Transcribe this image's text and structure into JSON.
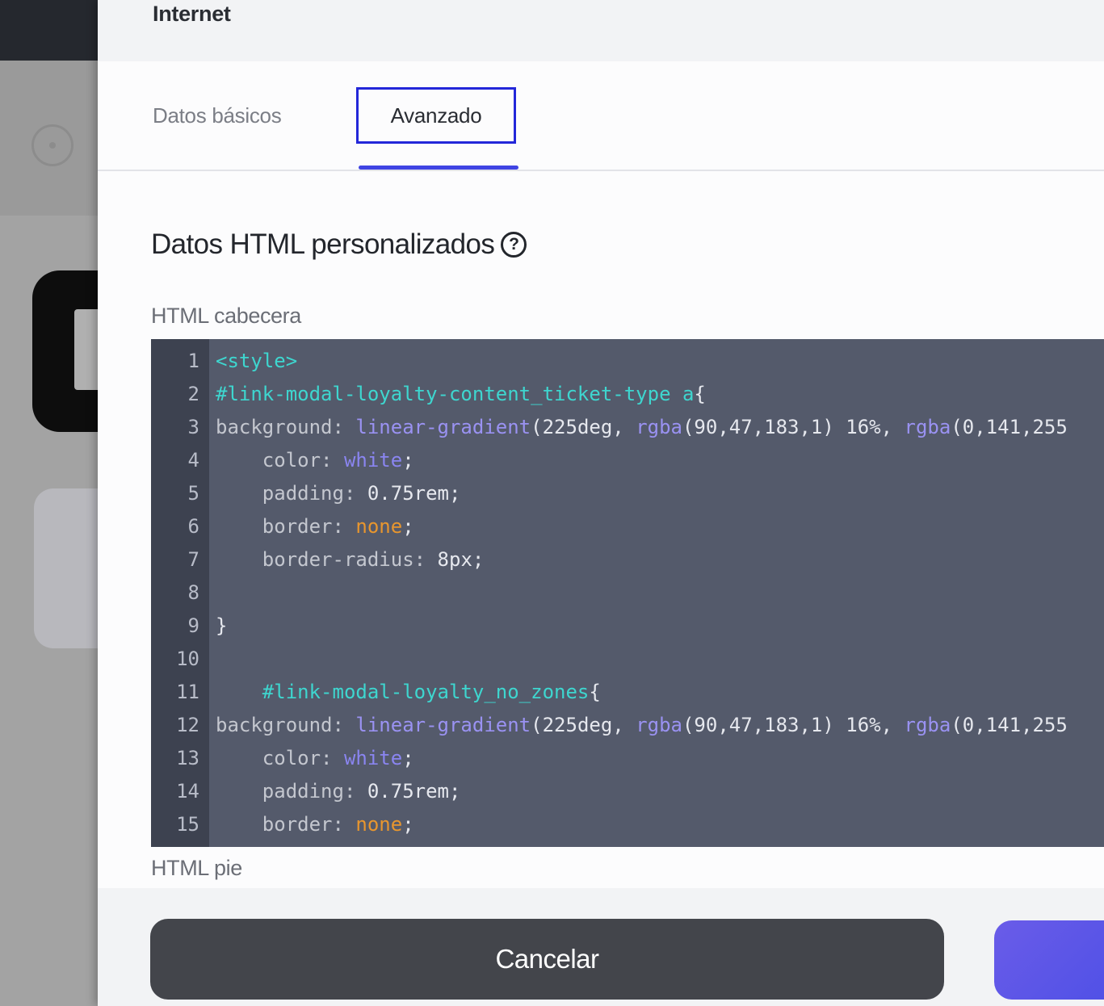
{
  "modal": {
    "title": "Internet",
    "tabs": [
      {
        "label": "Datos básicos",
        "active": false
      },
      {
        "label": "Avanzado",
        "active": true
      }
    ],
    "section_title": "Datos HTML personalizados",
    "help_icon_glyph": "?",
    "fields": {
      "head_label": "HTML cabecera",
      "foot_label": "HTML pie"
    },
    "editor": {
      "line_numbers": [
        "1",
        "2",
        "3",
        "4",
        "5",
        "6",
        "7",
        "8",
        "9",
        "10",
        "11",
        "12",
        "13",
        "14",
        "15"
      ],
      "lines": [
        {
          "tokens": [
            {
              "t": "<style>",
              "c": "tag"
            }
          ]
        },
        {
          "tokens": [
            {
              "t": "#link-modal-loyalty-content_ticket-type a",
              "c": "sel"
            },
            {
              "t": "{",
              "c": "val"
            }
          ]
        },
        {
          "tokens": [
            {
              "t": "background: ",
              "c": "prop"
            },
            {
              "t": "linear-gradient",
              "c": "fn"
            },
            {
              "t": "(225deg, ",
              "c": "val"
            },
            {
              "t": "rgba",
              "c": "fn"
            },
            {
              "t": "(90,47,183,1) 16%, ",
              "c": "val"
            },
            {
              "t": "rgba",
              "c": "fn"
            },
            {
              "t": "(0,141,255",
              "c": "val"
            }
          ]
        },
        {
          "tokens": [
            {
              "t": "    color: ",
              "c": "prop"
            },
            {
              "t": "white",
              "c": "kw"
            },
            {
              "t": ";",
              "c": "val"
            }
          ]
        },
        {
          "tokens": [
            {
              "t": "    padding: ",
              "c": "prop"
            },
            {
              "t": "0.75rem;",
              "c": "val"
            }
          ]
        },
        {
          "tokens": [
            {
              "t": "    border: ",
              "c": "prop"
            },
            {
              "t": "none",
              "c": "none"
            },
            {
              "t": ";",
              "c": "val"
            }
          ]
        },
        {
          "tokens": [
            {
              "t": "    border-radius: ",
              "c": "prop"
            },
            {
              "t": "8px;",
              "c": "val"
            }
          ]
        },
        {
          "tokens": []
        },
        {
          "tokens": [
            {
              "t": "}",
              "c": "val"
            }
          ]
        },
        {
          "tokens": []
        },
        {
          "tokens": [
            {
              "t": "    #link-modal-loyalty_no_zones",
              "c": "sel"
            },
            {
              "t": "{",
              "c": "val"
            }
          ]
        },
        {
          "tokens": [
            {
              "t": "background: ",
              "c": "prop"
            },
            {
              "t": "linear-gradient",
              "c": "fn"
            },
            {
              "t": "(225deg, ",
              "c": "val"
            },
            {
              "t": "rgba",
              "c": "fn"
            },
            {
              "t": "(90,47,183,1) 16%, ",
              "c": "val"
            },
            {
              "t": "rgba",
              "c": "fn"
            },
            {
              "t": "(0,141,255",
              "c": "val"
            }
          ]
        },
        {
          "tokens": [
            {
              "t": "    color: ",
              "c": "prop"
            },
            {
              "t": "white",
              "c": "kw"
            },
            {
              "t": ";",
              "c": "val"
            }
          ]
        },
        {
          "tokens": [
            {
              "t": "    padding: ",
              "c": "prop"
            },
            {
              "t": "0.75rem;",
              "c": "val"
            }
          ]
        },
        {
          "tokens": [
            {
              "t": "    border: ",
              "c": "prop"
            },
            {
              "t": "none",
              "c": "none"
            },
            {
              "t": ";",
              "c": "val"
            }
          ]
        }
      ]
    },
    "buttons": {
      "cancel_label": "Cancelar"
    }
  },
  "colors": {
    "accent": "#3f44e3",
    "editor_bg": "#545a6b",
    "gutter_bg": "#3d4250",
    "cancel_bg": "#43454b",
    "primary_bg": "#5a55e6"
  }
}
